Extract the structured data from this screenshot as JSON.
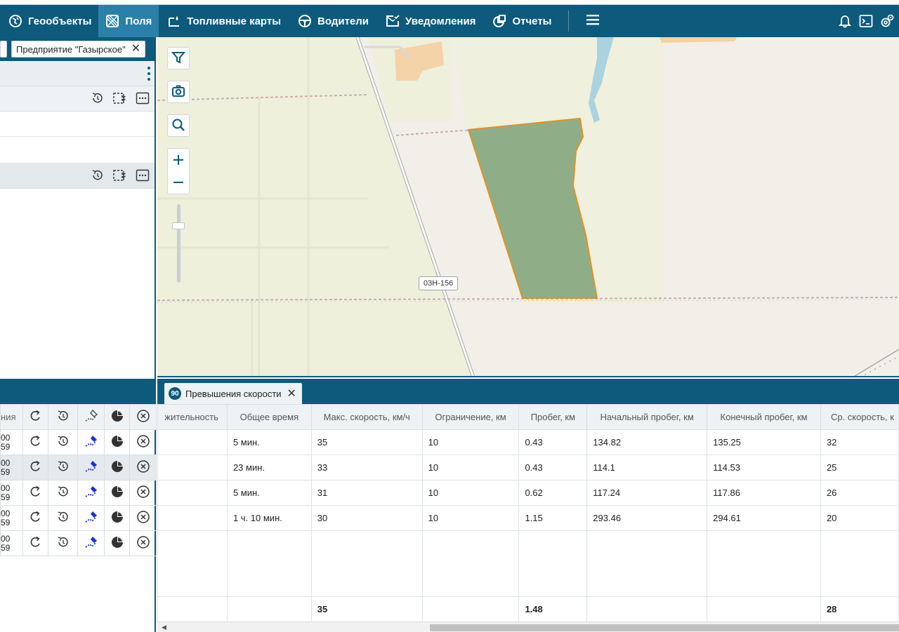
{
  "nav": {
    "items": [
      {
        "label": "Геообъекты",
        "icon": "globe-icon",
        "active": false
      },
      {
        "label": "Поля",
        "icon": "field-icon",
        "active": true
      },
      {
        "label": "Топливные карты",
        "icon": "fuel-card-icon",
        "active": false
      },
      {
        "label": "Водители",
        "icon": "steering-wheel-icon",
        "active": false
      },
      {
        "label": "Уведомления",
        "icon": "envelope-check-icon",
        "active": false
      },
      {
        "label": "Отчеты",
        "icon": "report-icon",
        "active": false
      }
    ],
    "right_icons": [
      "bell-icon",
      "console-icon",
      "settings-icon"
    ]
  },
  "left_panel": {
    "filter_chip": "Предприятие \"Газырское\""
  },
  "map": {
    "road_label": "03Н-156",
    "field_fill": "#8fae88",
    "field_stroke": "#e0912a"
  },
  "bottom_left": {
    "header_label": "ния",
    "rows": [
      {
        "line1": "00",
        "line2": "59"
      },
      {
        "line1": "00",
        "line2": "59"
      },
      {
        "line1": "00",
        "line2": "59"
      },
      {
        "line1": "00",
        "line2": "59"
      },
      {
        "line1": "00",
        "line2": "59"
      }
    ]
  },
  "report": {
    "tab_badge": "90",
    "tab_label": "Превышения скорости",
    "columns": [
      "жительность",
      "Общее время",
      "Макс. скорость, км/ч",
      "Ограничение, км",
      "Пробег, км",
      "Начальный пробег, км",
      "Конечный пробег, км",
      "Ср. скорость, к"
    ],
    "rows": [
      [
        "",
        "5 мин.",
        "35",
        "10",
        "0.43",
        "134.82",
        "135.25",
        "32"
      ],
      [
        "",
        "23 мин.",
        "33",
        "10",
        "0.43",
        "114.1",
        "114.53",
        "25"
      ],
      [
        "",
        "5 мин.",
        "31",
        "10",
        "0.62",
        "117.24",
        "117.86",
        "26"
      ],
      [
        "",
        "1 ч. 10 мин.",
        "30",
        "10",
        "1.15",
        "293.46",
        "294.61",
        "20"
      ]
    ],
    "totals": [
      "",
      "",
      "35",
      "",
      "1.48",
      "",
      "",
      "28"
    ]
  },
  "colors": {
    "brand": "#0d5a7c",
    "active_tab": "#2a80a8"
  }
}
